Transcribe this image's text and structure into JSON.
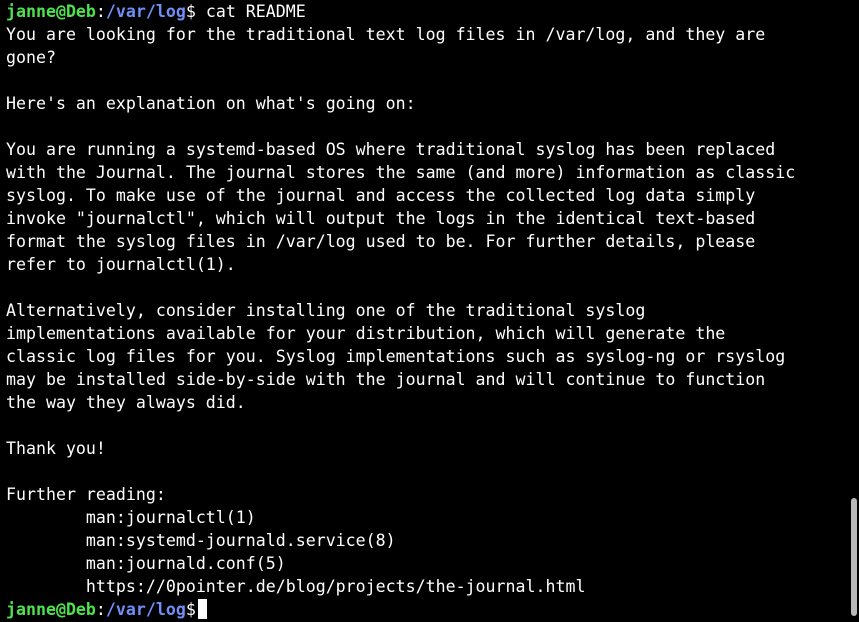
{
  "prompt": {
    "user_host": "janne@Deb",
    "colon": ":",
    "path": "/var/log",
    "dollar": "$"
  },
  "command": " cat README",
  "output": [
    "You are looking for the traditional text log files in /var/log, and they are",
    "gone?",
    "",
    "Here's an explanation on what's going on:",
    "",
    "You are running a systemd-based OS where traditional syslog has been replaced",
    "with the Journal. The journal stores the same (and more) information as classic",
    "syslog. To make use of the journal and access the collected log data simply",
    "invoke \"journalctl\", which will output the logs in the identical text-based",
    "format the syslog files in /var/log used to be. For further details, please",
    "refer to journalctl(1).",
    "",
    "Alternatively, consider installing one of the traditional syslog",
    "implementations available for your distribution, which will generate the",
    "classic log files for you. Syslog implementations such as syslog-ng or rsyslog",
    "may be installed side-by-side with the journal and will continue to function",
    "the way they always did.",
    "",
    "Thank you!",
    "",
    "Further reading:",
    "        man:journalctl(1)",
    "        man:systemd-journald.service(8)",
    "        man:journald.conf(5)",
    "        https://0pointer.de/blog/projects/the-journal.html"
  ],
  "colors": {
    "background": "#000000",
    "foreground": "#ffffff",
    "prompt_user": "#4ee24e",
    "prompt_path": "#6f8ff7"
  }
}
